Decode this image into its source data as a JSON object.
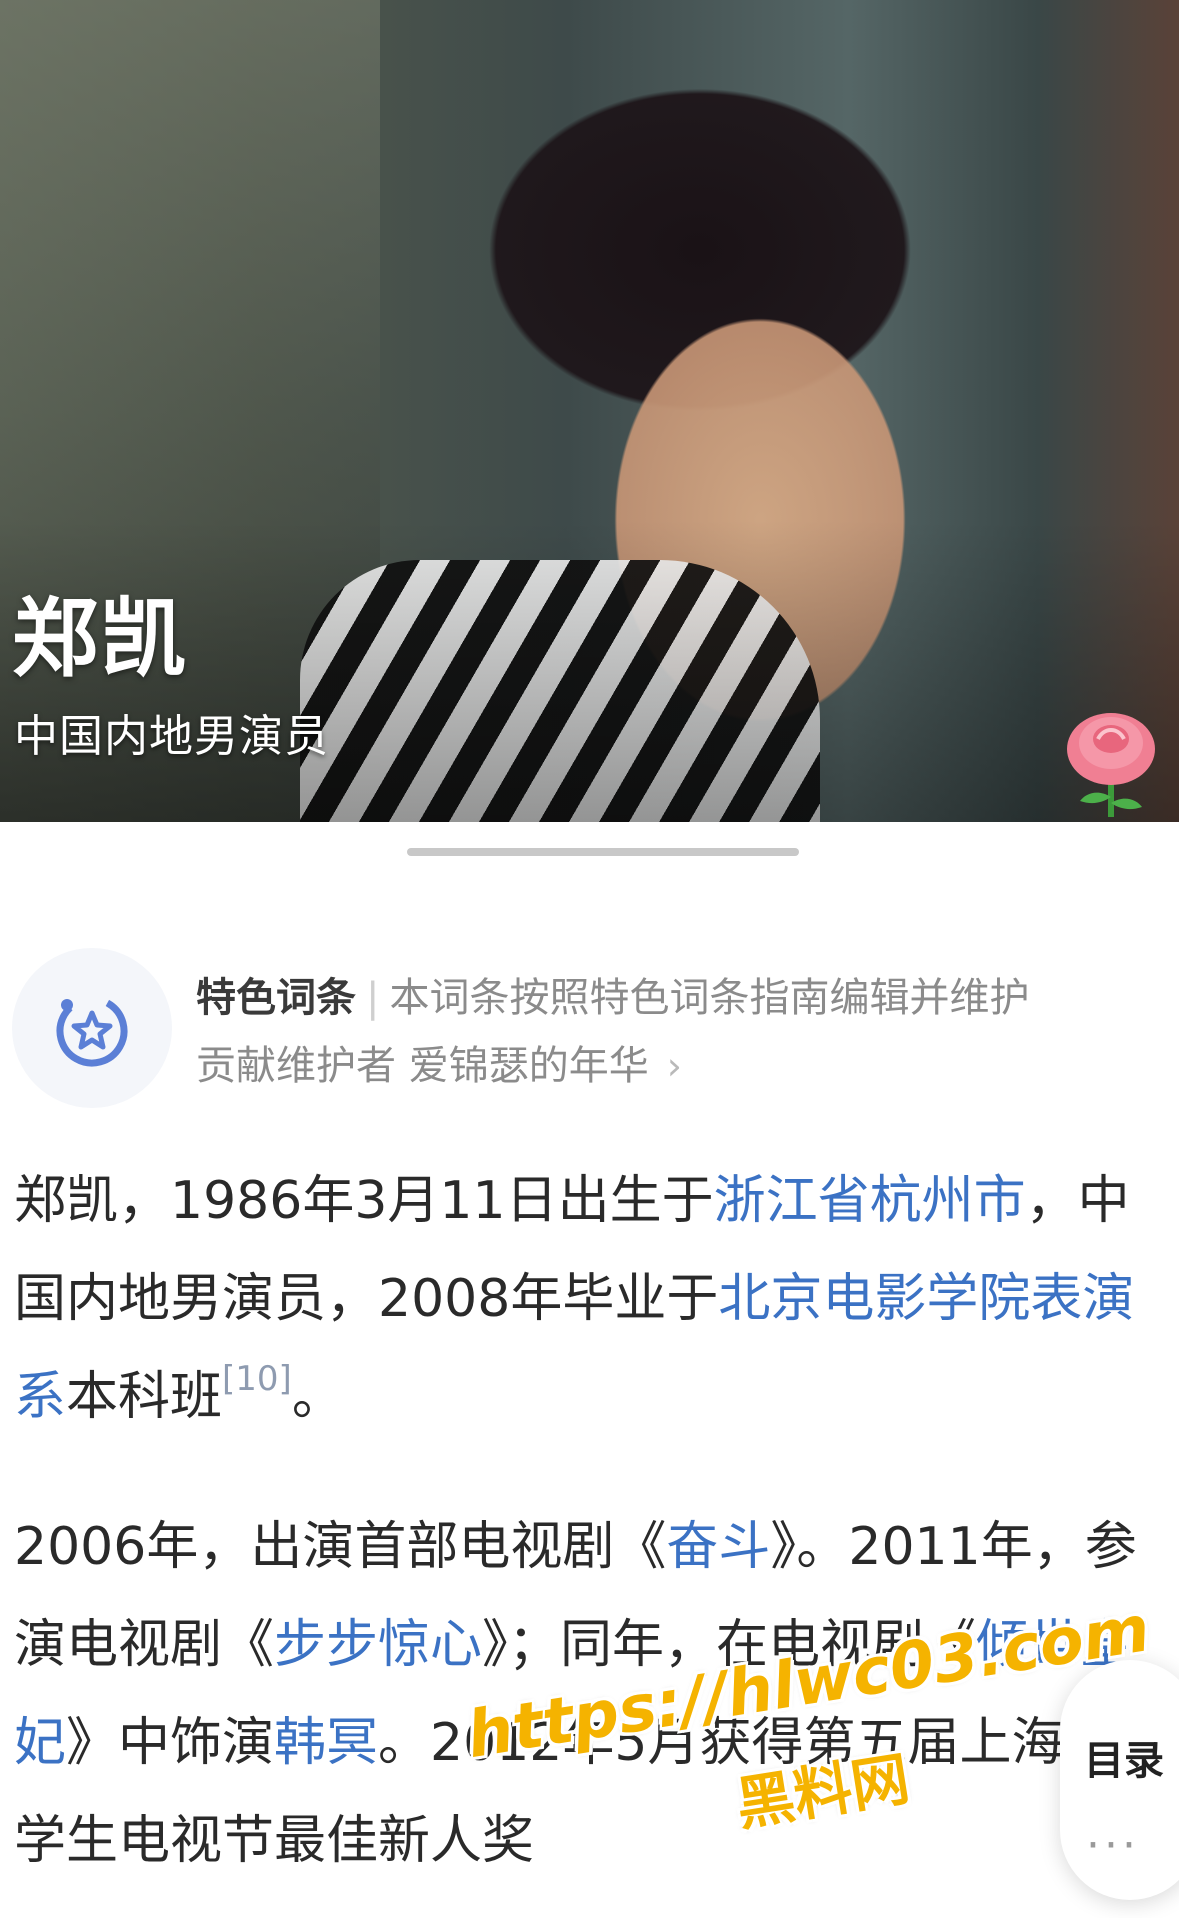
{
  "hero": {
    "title": "郑凯",
    "subtitle": "中国内地男演员",
    "decoration_icon": "rose-icon"
  },
  "featured": {
    "icon": "featured-star-icon",
    "label": "特色词条",
    "separator": "|",
    "description": "本词条按照特色词条指南编辑并维护",
    "maintainer_prefix": "贡献维护者",
    "maintainer_name": "爱锦瑟的年华",
    "chevron": "›"
  },
  "intro": {
    "t1": "郑凯，1986年3月11日出生于",
    "link1": "浙江省杭州市",
    "t2": "，中国内地男演员，2008年毕业于",
    "link2": "北京电影学院表演系",
    "t3": "本科班",
    "cite": "[10]",
    "t4": "。"
  },
  "career": {
    "t1": "2006年，出演首部电视剧《",
    "link1": "奋斗",
    "t2": "》。2011年，参演电视剧《",
    "link2": "步步惊心",
    "t3": "》；同年，在电视剧《",
    "link3": "倾世皇妃",
    "t4": "》中饰演",
    "link4": "韩冥",
    "t5": "。2012年5月获得第五届上海大学生电视节最佳新人奖"
  },
  "toc": {
    "label": "目录",
    "more": "···"
  },
  "watermark": {
    "url": "https://hlwc03.com",
    "name": "黑料网"
  },
  "colors": {
    "link": "#3b72c4",
    "badge_icon": "#5b7fd6",
    "watermark": "#f5b300"
  }
}
